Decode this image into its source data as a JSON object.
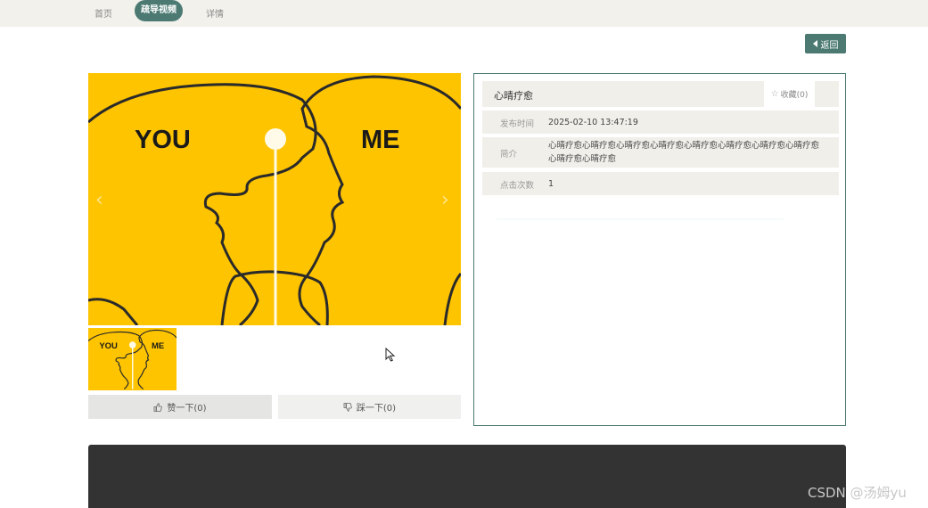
{
  "breadcrumb": {
    "home": "首页",
    "current": "疏导视频",
    "detail": "详情"
  },
  "toolbar": {
    "back_label": "返回"
  },
  "viewer": {
    "left_text": "YOU",
    "right_text": "ME",
    "bg_color": "#fec400",
    "prev_icon": "chevron-left-icon",
    "next_icon": "chevron-right-icon"
  },
  "votes": {
    "like_label": "赞一下(0)",
    "dislike_label": "踩一下(0)"
  },
  "info": {
    "title": "心晴疗愈",
    "favorite_label": "收藏(0)",
    "rows": [
      {
        "label": "发布时间",
        "value": "2025-02-10 13:47:19"
      },
      {
        "label": "简介",
        "value": "心晴疗愈心晴疗愈心晴疗愈心晴疗愈心晴疗愈心晴疗愈心晴疗愈心晴疗愈心晴疗愈心晴疗愈"
      },
      {
        "label": "点击次数",
        "value": "1"
      }
    ]
  },
  "watermark": "CSDN @汤姆yu",
  "colors": {
    "accent": "#4c7a73",
    "topbar": "#f2f1ec",
    "footer": "#333333",
    "row_bg": "#f0efea"
  }
}
